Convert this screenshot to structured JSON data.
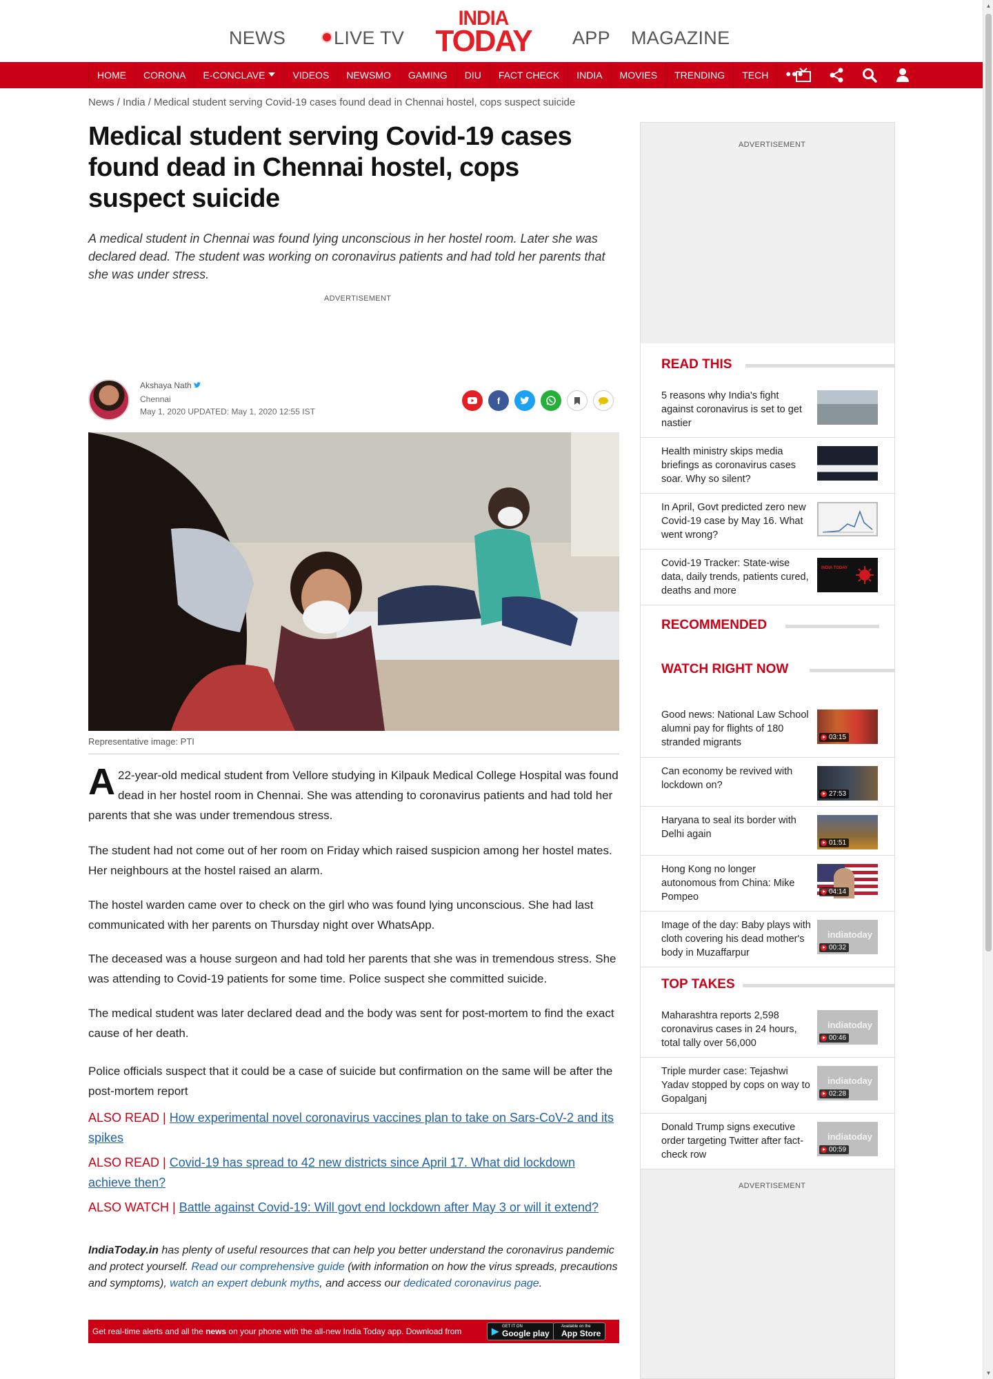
{
  "header": {
    "nav_left": [
      "NEWS",
      "LIVE TV"
    ],
    "logo_top": "INDIA",
    "logo_bottom": "TODAY",
    "nav_right": [
      "APP",
      "MAGAZINE"
    ]
  },
  "menu": {
    "items": [
      "HOME",
      "CORONA",
      "E-CONCLAVE",
      "VIDEOS",
      "NEWSMO",
      "GAMING",
      "DIU",
      "FACT CHECK",
      "INDIA",
      "MOVIES",
      "TRENDING",
      "TECH"
    ],
    "more": "•••",
    "icons": [
      "tv-icon",
      "share-icon",
      "search-icon",
      "user-icon"
    ]
  },
  "breadcrumb": "News / India / Medical student serving Covid-19 cases found dead in Chennai hostel, cops suspect suicide",
  "article": {
    "title": "Medical student serving Covid-19 cases found dead in Chennai hostel, cops suspect suicide",
    "summary": "A medical student in Chennai was found lying unconscious in her hostel room. Later she was declared dead. The student was working on coronavirus patients and had told her parents that she was under stress.",
    "ad_label": "ADVERTISEMENT",
    "author": "Akshaya Nath",
    "city": "Chennai",
    "date": "May 1, 2020  UPDATED: May 1, 2020 12:55 IST",
    "caption": "Representative image: PTI",
    "dropcap": "A",
    "p1": "22-year-old medical student from Vellore studying in Kilpauk Medical College Hospital was found dead in her hostel room in Chennai. She was attending to coronavirus patients and had told her parents that she was under tremendous stress.",
    "p2": "The student had not come out of her room on Friday which raised suspicion among her hostel mates. Her neighbours at the hostel raised an alarm.",
    "p3": "The hostel warden came over to check on the girl who was found lying unconscious. She had last communicated with her parents on Thursday night over WhatsApp.",
    "p4": "The deceased was a house surgeon and had told her parents that she was in tremendous stress. She was attending to Covid-19 patients for some time. Police suspect she committed suicide.",
    "p5": "The medical student was later declared dead and the body was sent for post-mortem to find the exact cause of her death.",
    "p6": "Police officials suspect that it could be a case of suicide but confirmation on the same will be after the post-mortem report",
    "also": [
      {
        "label": "ALSO READ | ",
        "link": "How experimental novel coronavirus vaccines plan to take on Sars-CoV-2 and its spikes"
      },
      {
        "label": "ALSO READ | ",
        "link": "Covid-19 has spread to 42 new districts since April 17. What did lockdown achieve then?"
      },
      {
        "label": "ALSO WATCH | ",
        "link": "Battle against Covid-19: Will govt end lockdown after May 3 or will it extend?"
      }
    ],
    "resources": {
      "brand": "IndiaToday.in",
      "t1": " has plenty of useful resources that can help you better understand the coronavirus pandemic and protect yourself. ",
      "l1": "Read our comprehensive guide",
      "t2": " (with information on how the virus spreads, precautions and symptoms), ",
      "l2": "watch an expert debunk myths",
      "t3": ", and access our ",
      "l3": "dedicated coronavirus page",
      "t4": "."
    },
    "appbar": {
      "pre": "Get real-time alerts and all the ",
      "bold": "news",
      "post": " on your phone with the all-new India Today app. Download from",
      "google_small": "GET IT ON",
      "google": "Google play",
      "apple_small": "Available on the",
      "apple": "App Store"
    }
  },
  "sidebar": {
    "ad_label": "ADVERTISEMENT",
    "read_this": {
      "heading": "READ THIS",
      "items": [
        "5 reasons why India's fight against coronavirus is set to get nastier",
        "Health ministry skips media briefings as coronavirus cases soar. Why so silent?",
        "In April, Govt predicted zero new Covid-19 case by May 16. What went wrong?",
        "Covid-19 Tracker: State-wise data, daily trends, patients cured, deaths and more"
      ]
    },
    "recommended": "RECOMMENDED",
    "watch": {
      "heading": "WATCH RIGHT NOW",
      "items": [
        {
          "title": "Good news: National Law School alumni pay for flights of 180 stranded migrants",
          "duration": "03:15"
        },
        {
          "title": "Can economy be revived with lockdown on?",
          "duration": "27:53"
        },
        {
          "title": "Haryana to seal its border with Delhi again",
          "duration": "01:51"
        },
        {
          "title": "Hong Kong no longer autonomous from China: Mike Pompeo",
          "duration": "04:14"
        },
        {
          "title": "Image of the day: Baby plays with cloth covering his dead mother's body in Muzaffarpur",
          "duration": "00:32"
        }
      ]
    },
    "top_takes": {
      "heading": "TOP TAKES",
      "items": [
        {
          "title": "Maharashtra reports 2,598 coronavirus cases in 24 hours, total tally over 56,000",
          "duration": "00:46"
        },
        {
          "title": "Triple murder case: Tejashwi Yadav stopped by cops on way to Gopalganj",
          "duration": "02:28"
        },
        {
          "title": "Donald Trump signs executive order targeting Twitter after fact-check row",
          "duration": "00:59"
        }
      ]
    },
    "thumb_watermark": "indiatoday",
    "tracker_thumb": "INDIA TODAY"
  },
  "colors": {
    "brand_red": "#c90016",
    "link_blue": "#1f61a8"
  }
}
